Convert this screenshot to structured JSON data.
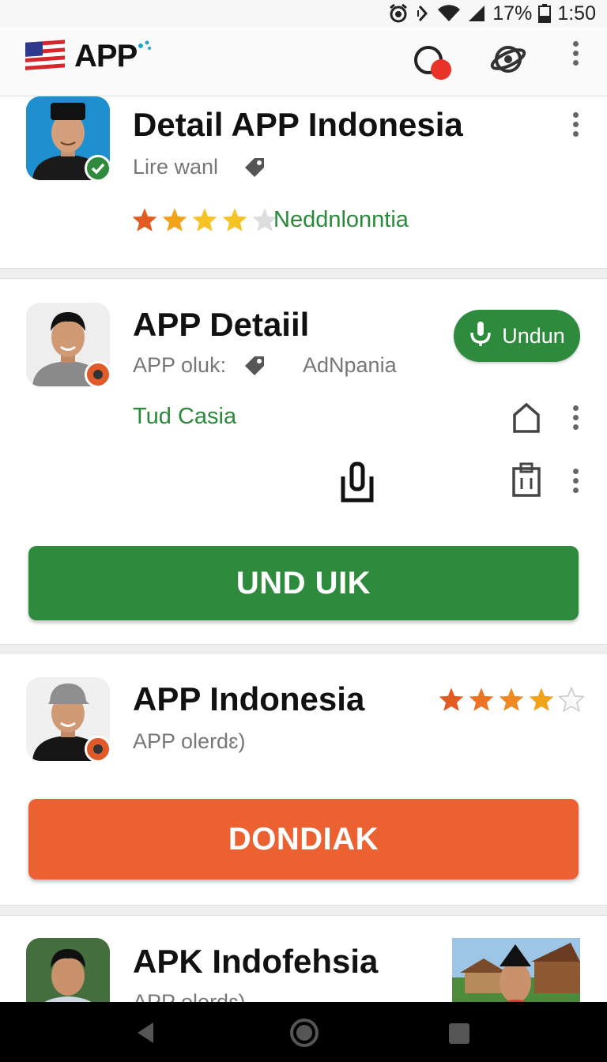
{
  "status_bar": {
    "battery": "17%",
    "time": "1:50"
  },
  "app_bar": {
    "logo_text": "APP"
  },
  "cards": [
    {
      "title": "Detail APP Indonesia",
      "subtitle": "Lire wanl",
      "rating": 3.5,
      "tag": "Neddnlonntia"
    },
    {
      "title": "APP Detaiil",
      "subtitle": "APP oluk:",
      "subtitle_right": "AdNpania",
      "tag": "Tud Casia",
      "pill_label": "Undun",
      "button_label": "UND UIK"
    },
    {
      "title": "APP Indonesia",
      "subtitle": "APP olerdɛ)",
      "rating": 4.5,
      "button_label": "DONDIAK"
    },
    {
      "title": "APK Indofehsia",
      "subtitle": "APP olerdɛ)"
    }
  ],
  "colors": {
    "green": "#2e8b3e",
    "orange": "#ec6132",
    "star": "#f2a31b",
    "notification": "#e8322a"
  },
  "icons": [
    "flag-icon",
    "notification-icon",
    "globe-icon",
    "more-vert-icon",
    "verified-icon",
    "tag-icon",
    "mic-icon",
    "bookmark-icon",
    "clipboard-icon",
    "back-icon",
    "home-icon",
    "recents-icon"
  ]
}
